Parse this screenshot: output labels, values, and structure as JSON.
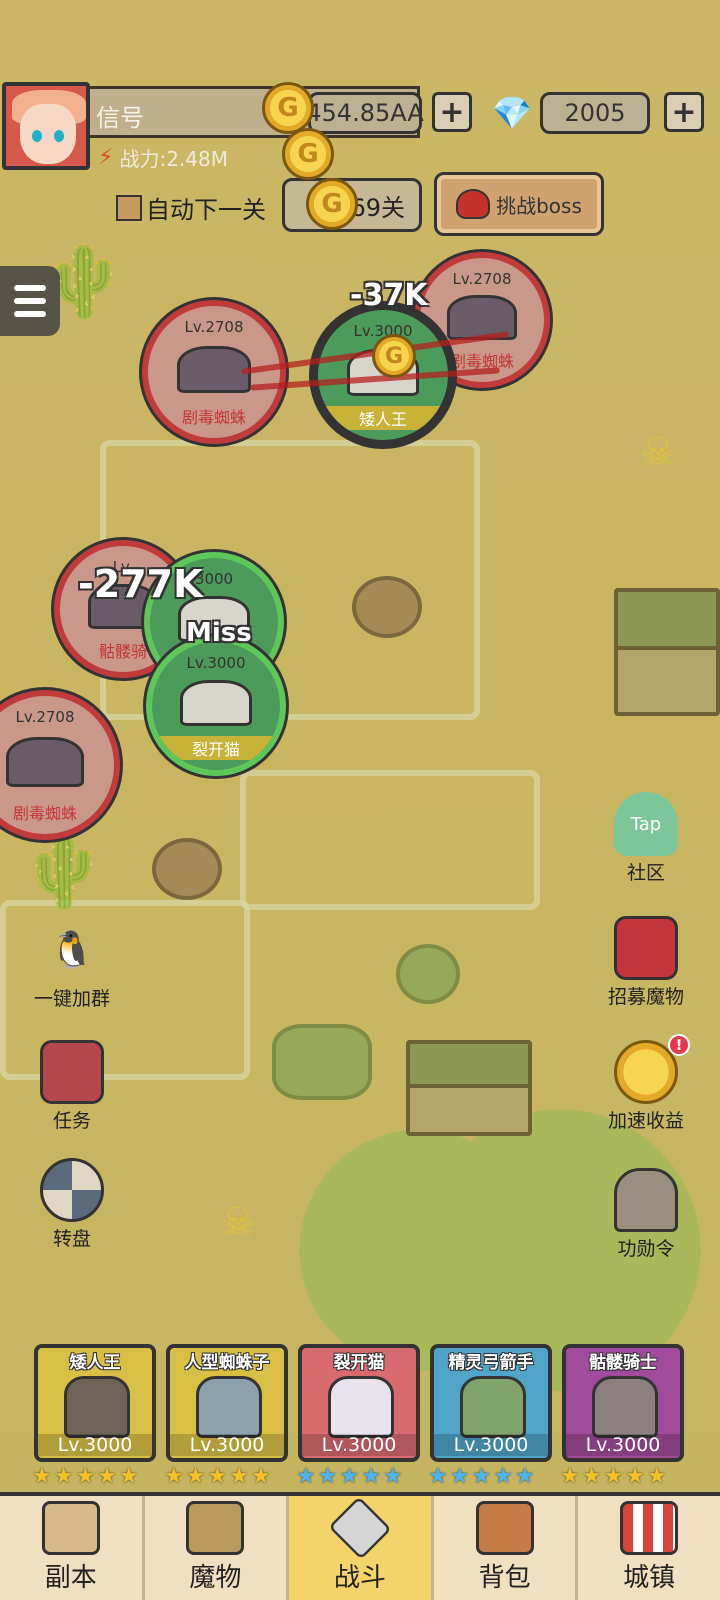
{
  "header": {
    "player_name": "信号",
    "combat_power": "战力:2.48M",
    "gold": "454.85AA",
    "gems": "2005",
    "plus": "+"
  },
  "controls": {
    "auto_next": "自动下一关",
    "stage": "69关",
    "boss_label": "挑战boss"
  },
  "battle": {
    "enemies": [
      {
        "level": "Lv.2708",
        "name": "剧毒蜘蛛"
      },
      {
        "level": "Lv.2708",
        "name": "剧毒蜘蛛"
      },
      {
        "level": "Lv.",
        "name": "骷髅骑"
      },
      {
        "level": "Lv.2708",
        "name": "剧毒蜘蛛"
      }
    ],
    "allies": [
      {
        "level": "Lv.3000",
        "name": "矮人王"
      },
      {
        "level": "3000"
      },
      {
        "level": "Lv.3000",
        "name": "裂开猫"
      }
    ],
    "damage_1": "-37K",
    "damage_2": "-277K",
    "miss": "Miss"
  },
  "left_buttons": [
    "一键加群",
    "任务",
    "转盘"
  ],
  "right_buttons": {
    "tap": "Tap",
    "community": "社区",
    "recruit": "招募魔物",
    "speed": "加速收益",
    "badge": "!",
    "merit": "功勋令"
  },
  "heroes": [
    {
      "name": "矮人王",
      "level": "Lv.3000",
      "stars": "gold"
    },
    {
      "name": "人型蜘蛛子",
      "level": "Lv.3000",
      "stars": "gold"
    },
    {
      "name": "裂开猫",
      "level": "Lv.3000",
      "stars": "blue"
    },
    {
      "name": "精灵弓箭手",
      "level": "Lv.3000",
      "stars": "blue"
    },
    {
      "name": "骷髅骑士",
      "level": "Lv.3000",
      "stars": "gold"
    }
  ],
  "nav": [
    "副本",
    "魔物",
    "战斗",
    "背包",
    "城镇"
  ],
  "colors": {
    "gold_star": "#f5c226",
    "blue_star": "#4db4ef",
    "active_tab": "#f4d46a"
  }
}
